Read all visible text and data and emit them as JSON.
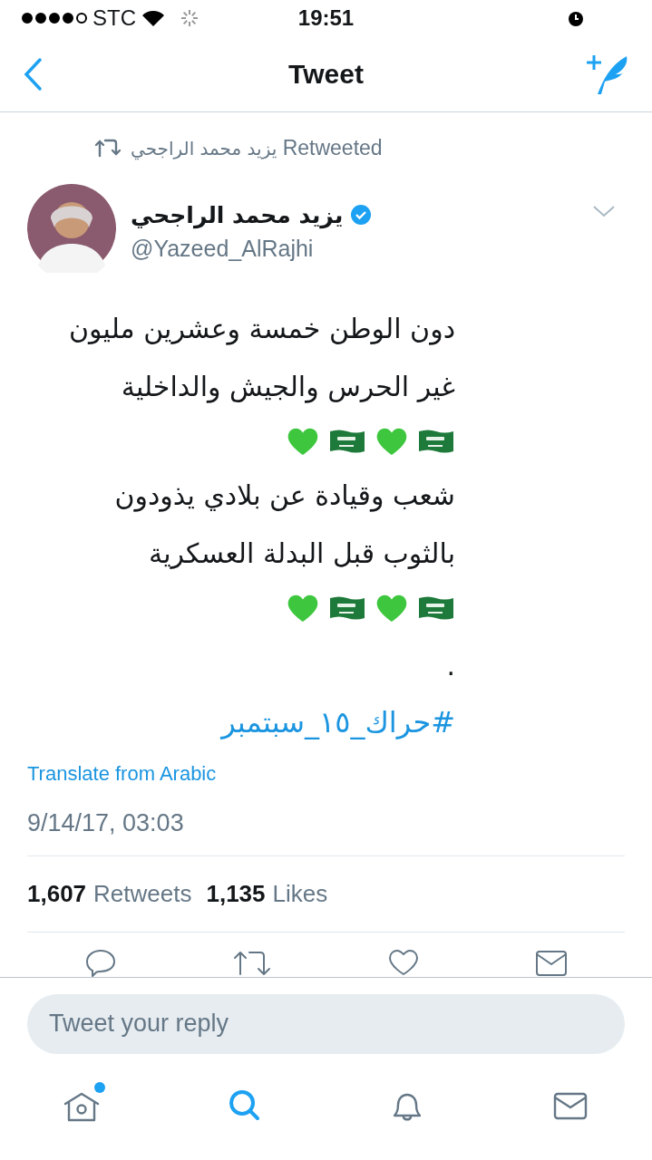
{
  "status_bar": {
    "carrier": "STC",
    "time": "19:51"
  },
  "nav": {
    "title": "Tweet"
  },
  "retweet_note": {
    "name": "يزيد محمد الراجحي",
    "label": "Retweeted"
  },
  "author": {
    "name": "يزيد محمد الراجحي",
    "verified": true,
    "handle": "@Yazeed_AlRajhi"
  },
  "tweet_lines": [
    {
      "kind": "text",
      "text": "دون الوطن خمسة وعشرين مليون"
    },
    {
      "kind": "text",
      "text": "غير الحرس والجيش والداخلية"
    },
    {
      "kind": "emoji",
      "icons": [
        {
          "kind": "flag"
        },
        {
          "kind": "heart"
        },
        {
          "kind": "flag"
        },
        {
          "kind": "heart"
        }
      ]
    },
    {
      "kind": "text",
      "text": "شعب وقيادة عن بلادي يذودون"
    },
    {
      "kind": "text",
      "text": "بالثوب قبل البدلة العسكرية"
    },
    {
      "kind": "emoji",
      "icons": [
        {
          "kind": "flag"
        },
        {
          "kind": "heart"
        },
        {
          "kind": "flag"
        },
        {
          "kind": "heart"
        }
      ]
    },
    {
      "kind": "spacer"
    },
    {
      "kind": "text",
      "text": "."
    },
    {
      "kind": "hashtag",
      "text": "#حراك_١٥_سبتمبر"
    }
  ],
  "translate_link": "Translate from Arabic",
  "timestamp": "9/14/17, 03:03",
  "stats": {
    "retweets": {
      "count": "1,607",
      "label": "Retweets"
    },
    "likes": {
      "count": "1,135",
      "label": "Likes"
    }
  },
  "actions": [
    {
      "kind": "reply"
    },
    {
      "kind": "retweet"
    },
    {
      "kind": "like"
    },
    {
      "kind": "message"
    }
  ],
  "reply_field": {
    "placeholder": "Tweet your reply"
  },
  "tab_bar": [
    {
      "kind": "home",
      "selected": false,
      "badge": true
    },
    {
      "kind": "search",
      "selected": true,
      "badge": false
    },
    {
      "kind": "notifications",
      "selected": false,
      "badge": false
    },
    {
      "kind": "messages",
      "selected": false,
      "badge": false
    }
  ]
}
